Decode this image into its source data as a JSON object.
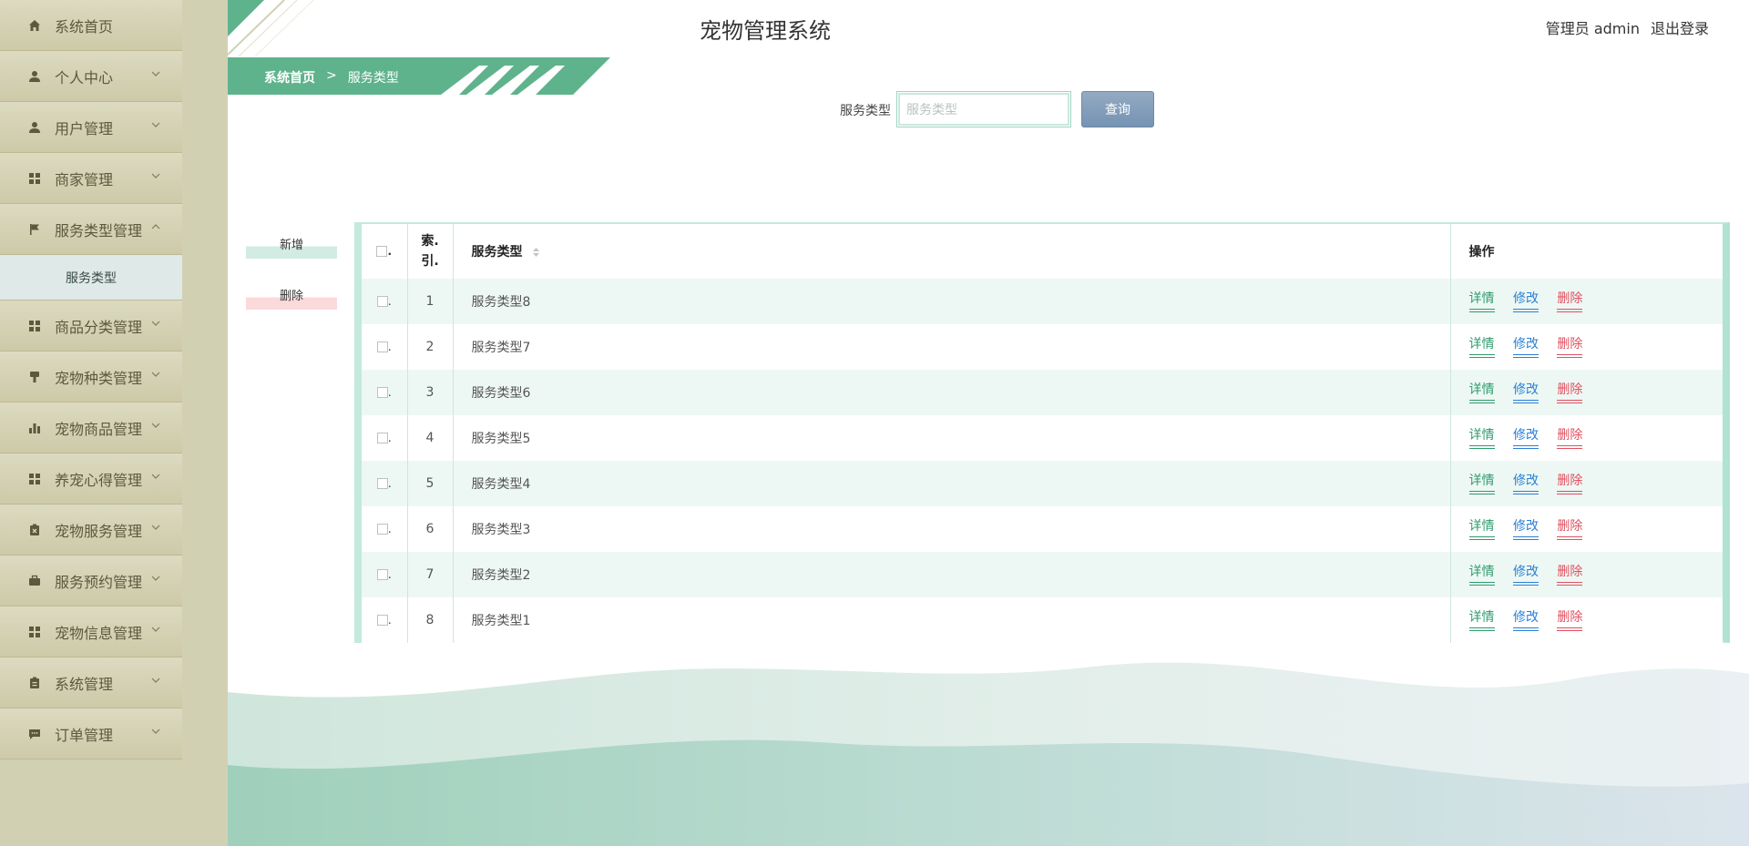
{
  "app": {
    "title": "宠物管理系统",
    "user_label": "管理员 admin",
    "logout_label": "退出登录"
  },
  "sidebar": {
    "items": [
      {
        "label": "系统首页",
        "icon": "home-icon",
        "chevron": false
      },
      {
        "label": "个人中心",
        "icon": "user-icon",
        "chevron": true
      },
      {
        "label": "用户管理",
        "icon": "user-icon",
        "chevron": true
      },
      {
        "label": "商家管理",
        "icon": "grid-icon",
        "chevron": true
      },
      {
        "label": "服务类型管理",
        "icon": "flag-icon",
        "chevron": true,
        "expanded": true
      },
      {
        "label": "商品分类管理",
        "icon": "grid-icon",
        "chevron": true
      },
      {
        "label": "宠物种类管理",
        "icon": "brush-icon",
        "chevron": true
      },
      {
        "label": "宠物商品管理",
        "icon": "bar-chart-icon",
        "chevron": true
      },
      {
        "label": "养宠心得管理",
        "icon": "grid-icon",
        "chevron": true
      },
      {
        "label": "宠物服务管理",
        "icon": "clipboard-x-icon",
        "chevron": true
      },
      {
        "label": "服务预约管理",
        "icon": "briefcase-icon",
        "chevron": true
      },
      {
        "label": "宠物信息管理",
        "icon": "grid-icon",
        "chevron": true
      },
      {
        "label": "系统管理",
        "icon": "clipboard-icon",
        "chevron": true
      },
      {
        "label": "订单管理",
        "icon": "chat-icon",
        "chevron": true
      }
    ],
    "submenu": {
      "label": "服务类型"
    }
  },
  "breadcrumb": {
    "home": "系统首页",
    "separator": ">",
    "current": "服务类型"
  },
  "search": {
    "label": "服务类型",
    "placeholder": "服务类型",
    "value": "",
    "button_label": "查询"
  },
  "actions": {
    "add_label": "新增",
    "delete_label": "删除"
  },
  "table": {
    "headers": {
      "check": ".",
      "index": "索.引.",
      "index_line1": "索.",
      "index_line2": "引.",
      "name": "服务类型",
      "ops": "操作"
    },
    "rows": [
      {
        "index": "1",
        "name": "服务类型8"
      },
      {
        "index": "2",
        "name": "服务类型7"
      },
      {
        "index": "3",
        "name": "服务类型6"
      },
      {
        "index": "4",
        "name": "服务类型5"
      },
      {
        "index": "5",
        "name": "服务类型4"
      },
      {
        "index": "6",
        "name": "服务类型3"
      },
      {
        "index": "7",
        "name": "服务类型2"
      },
      {
        "index": "8",
        "name": "服务类型1"
      }
    ],
    "op_labels": {
      "detail": "详情",
      "edit": "修改",
      "delete": "删除"
    }
  },
  "colors": {
    "sidebar_bg": "#d2d0b3",
    "ribbon_green": "#5fb38c",
    "detail": "#2f9a6d",
    "edit": "#2b7fd6",
    "delete": "#e05060",
    "query_button": "#7f9ab7"
  }
}
